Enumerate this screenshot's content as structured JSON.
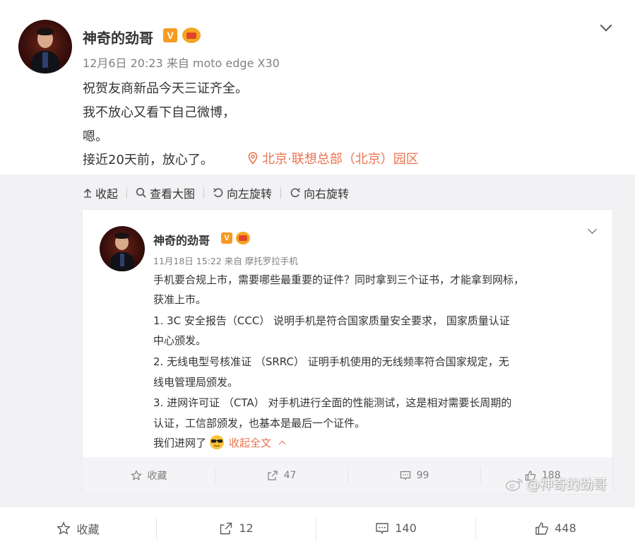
{
  "post": {
    "author": "神奇的劲哥",
    "badge_v": "V",
    "meta": "12月6日 20:23 来自 moto edge X30",
    "lines": [
      "祝贺友商新品今天三证齐全。",
      "我不放心又看下自己微博，",
      "嗯。",
      "接近20天前，放心了。"
    ],
    "location": "北京·联想总部（北京）园区",
    "toolbar": [
      "收起",
      "查看大图",
      "向左旋转",
      "向右旋转"
    ]
  },
  "screenshot": {
    "author": "神奇的劲哥",
    "badge_v": "V",
    "meta": "11月18日 15:22 来自 摩托罗拉手机",
    "lines": [
      "手机要合规上市，需要哪些最重要的证件？同时拿到三个证书，才能拿到网标，",
      "获准上市。",
      "1.     3C 安全报告（CCC）   说明手机是符合国家质量安全要求， 国家质量认证",
      "中心颁发。",
      "2.     无线电型号核准证 （SRRC）  证明手机使用的无线频率符合国家规定，无",
      "线电管理局颁发。",
      "3.     进网许可证 （CTA）   对手机进行全面的性能测试，这是相对需要长周期的",
      "认证，工信部颁发，也基本是最后一个证件。"
    ],
    "last_line": "我们进网了",
    "collapse": "收起全文",
    "actions": {
      "favorite": "收藏",
      "repost": "47",
      "comment": "99",
      "like": "188"
    },
    "watermark": "@神奇的劲哥"
  },
  "footer": {
    "favorite": "收藏",
    "repost": "12",
    "comment": "140",
    "like": "448"
  },
  "colors": {
    "accent": "#eb7350",
    "badge": "#f59a23",
    "panel": "#f2f2f5"
  }
}
